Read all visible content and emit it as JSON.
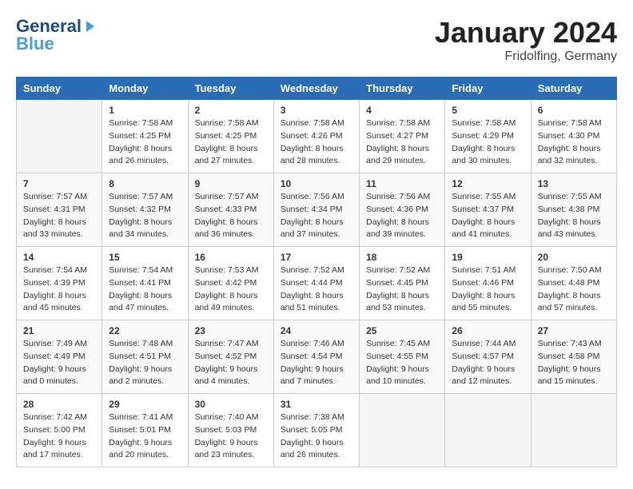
{
  "header": {
    "logo_general": "General",
    "logo_blue": "Blue",
    "month_title": "January 2024",
    "subtitle": "Fridolfing, Germany"
  },
  "days_of_week": [
    "Sunday",
    "Monday",
    "Tuesday",
    "Wednesday",
    "Thursday",
    "Friday",
    "Saturday"
  ],
  "weeks": [
    [
      {
        "day": "",
        "sunrise": "",
        "sunset": "",
        "daylight": "",
        "empty": true
      },
      {
        "day": "1",
        "sunrise": "Sunrise: 7:58 AM",
        "sunset": "Sunset: 4:25 PM",
        "daylight": "Daylight: 8 hours and 26 minutes."
      },
      {
        "day": "2",
        "sunrise": "Sunrise: 7:58 AM",
        "sunset": "Sunset: 4:25 PM",
        "daylight": "Daylight: 8 hours and 27 minutes."
      },
      {
        "day": "3",
        "sunrise": "Sunrise: 7:58 AM",
        "sunset": "Sunset: 4:26 PM",
        "daylight": "Daylight: 8 hours and 28 minutes."
      },
      {
        "day": "4",
        "sunrise": "Sunrise: 7:58 AM",
        "sunset": "Sunset: 4:27 PM",
        "daylight": "Daylight: 8 hours and 29 minutes."
      },
      {
        "day": "5",
        "sunrise": "Sunrise: 7:58 AM",
        "sunset": "Sunset: 4:29 PM",
        "daylight": "Daylight: 8 hours and 30 minutes."
      },
      {
        "day": "6",
        "sunrise": "Sunrise: 7:58 AM",
        "sunset": "Sunset: 4:30 PM",
        "daylight": "Daylight: 8 hours and 32 minutes."
      }
    ],
    [
      {
        "day": "7",
        "sunrise": "Sunrise: 7:57 AM",
        "sunset": "Sunset: 4:31 PM",
        "daylight": "Daylight: 8 hours and 33 minutes."
      },
      {
        "day": "8",
        "sunrise": "Sunrise: 7:57 AM",
        "sunset": "Sunset: 4:32 PM",
        "daylight": "Daylight: 8 hours and 34 minutes."
      },
      {
        "day": "9",
        "sunrise": "Sunrise: 7:57 AM",
        "sunset": "Sunset: 4:33 PM",
        "daylight": "Daylight: 8 hours and 36 minutes."
      },
      {
        "day": "10",
        "sunrise": "Sunrise: 7:56 AM",
        "sunset": "Sunset: 4:34 PM",
        "daylight": "Daylight: 8 hours and 37 minutes."
      },
      {
        "day": "11",
        "sunrise": "Sunrise: 7:56 AM",
        "sunset": "Sunset: 4:36 PM",
        "daylight": "Daylight: 8 hours and 39 minutes."
      },
      {
        "day": "12",
        "sunrise": "Sunrise: 7:55 AM",
        "sunset": "Sunset: 4:37 PM",
        "daylight": "Daylight: 8 hours and 41 minutes."
      },
      {
        "day": "13",
        "sunrise": "Sunrise: 7:55 AM",
        "sunset": "Sunset: 4:38 PM",
        "daylight": "Daylight: 8 hours and 43 minutes."
      }
    ],
    [
      {
        "day": "14",
        "sunrise": "Sunrise: 7:54 AM",
        "sunset": "Sunset: 4:39 PM",
        "daylight": "Daylight: 8 hours and 45 minutes."
      },
      {
        "day": "15",
        "sunrise": "Sunrise: 7:54 AM",
        "sunset": "Sunset: 4:41 PM",
        "daylight": "Daylight: 8 hours and 47 minutes."
      },
      {
        "day": "16",
        "sunrise": "Sunrise: 7:53 AM",
        "sunset": "Sunset: 4:42 PM",
        "daylight": "Daylight: 8 hours and 49 minutes."
      },
      {
        "day": "17",
        "sunrise": "Sunrise: 7:52 AM",
        "sunset": "Sunset: 4:44 PM",
        "daylight": "Daylight: 8 hours and 51 minutes."
      },
      {
        "day": "18",
        "sunrise": "Sunrise: 7:52 AM",
        "sunset": "Sunset: 4:45 PM",
        "daylight": "Daylight: 8 hours and 53 minutes."
      },
      {
        "day": "19",
        "sunrise": "Sunrise: 7:51 AM",
        "sunset": "Sunset: 4:46 PM",
        "daylight": "Daylight: 8 hours and 55 minutes."
      },
      {
        "day": "20",
        "sunrise": "Sunrise: 7:50 AM",
        "sunset": "Sunset: 4:48 PM",
        "daylight": "Daylight: 8 hours and 57 minutes."
      }
    ],
    [
      {
        "day": "21",
        "sunrise": "Sunrise: 7:49 AM",
        "sunset": "Sunset: 4:49 PM",
        "daylight": "Daylight: 9 hours and 0 minutes."
      },
      {
        "day": "22",
        "sunrise": "Sunrise: 7:48 AM",
        "sunset": "Sunset: 4:51 PM",
        "daylight": "Daylight: 9 hours and 2 minutes."
      },
      {
        "day": "23",
        "sunrise": "Sunrise: 7:47 AM",
        "sunset": "Sunset: 4:52 PM",
        "daylight": "Daylight: 9 hours and 4 minutes."
      },
      {
        "day": "24",
        "sunrise": "Sunrise: 7:46 AM",
        "sunset": "Sunset: 4:54 PM",
        "daylight": "Daylight: 9 hours and 7 minutes."
      },
      {
        "day": "25",
        "sunrise": "Sunrise: 7:45 AM",
        "sunset": "Sunset: 4:55 PM",
        "daylight": "Daylight: 9 hours and 10 minutes."
      },
      {
        "day": "26",
        "sunrise": "Sunrise: 7:44 AM",
        "sunset": "Sunset: 4:57 PM",
        "daylight": "Daylight: 9 hours and 12 minutes."
      },
      {
        "day": "27",
        "sunrise": "Sunrise: 7:43 AM",
        "sunset": "Sunset: 4:58 PM",
        "daylight": "Daylight: 9 hours and 15 minutes."
      }
    ],
    [
      {
        "day": "28",
        "sunrise": "Sunrise: 7:42 AM",
        "sunset": "Sunset: 5:00 PM",
        "daylight": "Daylight: 9 hours and 17 minutes."
      },
      {
        "day": "29",
        "sunrise": "Sunrise: 7:41 AM",
        "sunset": "Sunset: 5:01 PM",
        "daylight": "Daylight: 9 hours and 20 minutes."
      },
      {
        "day": "30",
        "sunrise": "Sunrise: 7:40 AM",
        "sunset": "Sunset: 5:03 PM",
        "daylight": "Daylight: 9 hours and 23 minutes."
      },
      {
        "day": "31",
        "sunrise": "Sunrise: 7:38 AM",
        "sunset": "Sunset: 5:05 PM",
        "daylight": "Daylight: 9 hours and 26 minutes."
      },
      {
        "day": "",
        "sunrise": "",
        "sunset": "",
        "daylight": "",
        "empty": true
      },
      {
        "day": "",
        "sunrise": "",
        "sunset": "",
        "daylight": "",
        "empty": true
      },
      {
        "day": "",
        "sunrise": "",
        "sunset": "",
        "daylight": "",
        "empty": true
      }
    ]
  ]
}
